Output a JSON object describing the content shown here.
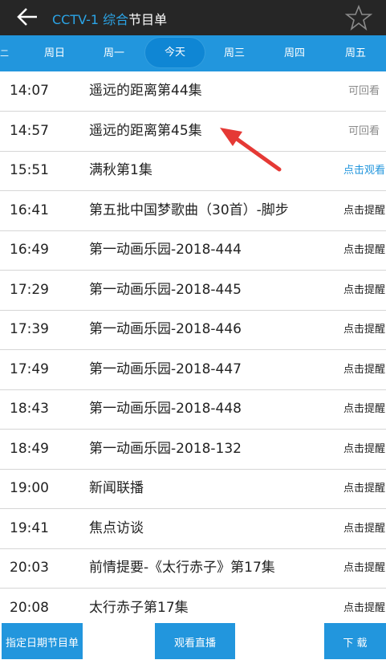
{
  "header": {
    "back_icon": "arrow-left-icon",
    "channel": "CCTV-1 综合",
    "title_suffix": "节目单",
    "favorite_icon": "star-outline-icon"
  },
  "tabs": {
    "edge": "二",
    "items": [
      {
        "label": "周日"
      },
      {
        "label": "周一"
      },
      {
        "label": "今天"
      },
      {
        "label": "周三"
      },
      {
        "label": "周四"
      },
      {
        "label": "周五"
      }
    ],
    "active": "今天"
  },
  "programs": [
    {
      "time": "14:07",
      "title": "遥远的距离第44集",
      "action": "可回看"
    },
    {
      "time": "14:57",
      "title": "遥远的距离第45集",
      "action": "可回看"
    },
    {
      "time": "15:51",
      "title": "满秋第1集",
      "action": "点击观看"
    },
    {
      "time": "16:41",
      "title": "第五批中国梦歌曲（30首）-脚步",
      "action": "点击提醒"
    },
    {
      "time": "16:49",
      "title": "第一动画乐园-2018-444",
      "action": "点击提醒"
    },
    {
      "time": "17:29",
      "title": "第一动画乐园-2018-445",
      "action": "点击提醒"
    },
    {
      "time": "17:39",
      "title": "第一动画乐园-2018-446",
      "action": "点击提醒"
    },
    {
      "time": "17:49",
      "title": "第一动画乐园-2018-447",
      "action": "点击提醒"
    },
    {
      "time": "18:43",
      "title": "第一动画乐园-2018-448",
      "action": "点击提醒"
    },
    {
      "time": "18:49",
      "title": "第一动画乐园-2018-132",
      "action": "点击提醒"
    },
    {
      "time": "19:00",
      "title": "新闻联播",
      "action": "点击提醒"
    },
    {
      "time": "19:41",
      "title": "焦点访谈",
      "action": "点击提醒"
    },
    {
      "time": "20:03",
      "title": "前情提要-《太行赤子》第17集",
      "action": "点击提醒"
    },
    {
      "time": "20:08",
      "title": "太行赤子第17集",
      "action": "点击提醒"
    }
  ],
  "bottom": {
    "date_schedule": "指定日期节目单",
    "watch_live": "观看直播",
    "download": "下 载"
  },
  "annotation": {
    "icon": "red-arrow-icon",
    "color": "#e53935"
  },
  "colors": {
    "accent": "#2296dd",
    "header": "#262626",
    "channel": "#2ba4e6"
  }
}
